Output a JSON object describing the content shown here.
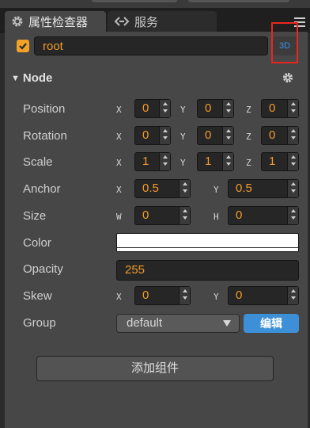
{
  "tabs": [
    {
      "label": "属性检查器",
      "icon": "gear-icon"
    },
    {
      "label": "服务",
      "icon": "link-icon"
    }
  ],
  "colors": {
    "accent": "#f29b2b",
    "blue": "#3d8fd8",
    "highlight": "#e8261e"
  },
  "node_name": "root",
  "btn_3d": "3D",
  "node_section": {
    "title": "Node"
  },
  "props": {
    "position": {
      "label": "Position",
      "x": "0",
      "y": "0",
      "z": "0"
    },
    "rotation": {
      "label": "Rotation",
      "x": "0",
      "y": "0",
      "z": "0"
    },
    "scale": {
      "label": "Scale",
      "x": "1",
      "y": "1",
      "z": "1"
    },
    "anchor": {
      "label": "Anchor",
      "x": "0.5",
      "y": "0.5"
    },
    "size": {
      "label": "Size",
      "w": "0",
      "h": "0"
    },
    "color": {
      "label": "Color",
      "value": "#ffffff"
    },
    "opacity": {
      "label": "Opacity",
      "value": "255"
    },
    "skew": {
      "label": "Skew",
      "x": "0",
      "y": "0"
    },
    "group": {
      "label": "Group",
      "value": "default",
      "edit_label": "编辑"
    }
  },
  "axis_labels": {
    "x": "X",
    "y": "Y",
    "z": "Z",
    "w": "W",
    "h": "H"
  },
  "add_component": "添加组件"
}
